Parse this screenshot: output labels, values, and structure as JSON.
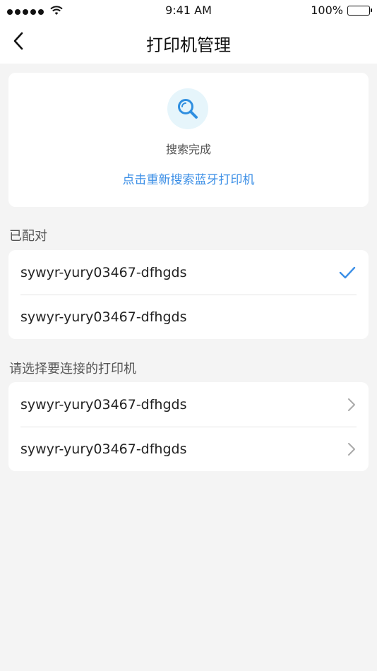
{
  "status_bar": {
    "time": "9:41 AM",
    "battery": "100%",
    "signal_dots": 5,
    "icons": [
      "signal-dots-icon",
      "wifi-icon",
      "battery-icon"
    ]
  },
  "nav": {
    "title": "打印机管理",
    "back_icon": "chevron-left-icon"
  },
  "search": {
    "icon": "search-icon",
    "status_text": "搜索完成",
    "research_link": "点击重新搜索蓝牙打印机"
  },
  "paired": {
    "header": "已配对",
    "items": [
      {
        "label": "sywyr-yury03467-dfhgds",
        "trail_icon": "checkmark-icon"
      },
      {
        "label": "sywyr-yury03467-dfhgds",
        "trail_icon": ""
      }
    ]
  },
  "available": {
    "header": "请选择要连接的打印机",
    "items": [
      {
        "label": "sywyr-yury03467-dfhgds",
        "trail_icon": "chevron-right-icon"
      },
      {
        "label": "sywyr-yury03467-dfhgds",
        "trail_icon": "chevron-right-icon"
      }
    ]
  },
  "colors": {
    "accent": "#3a8ee6",
    "background": "#f4f4f4",
    "card": "#ffffff",
    "search_icon_bg": "#e6f5fb"
  }
}
